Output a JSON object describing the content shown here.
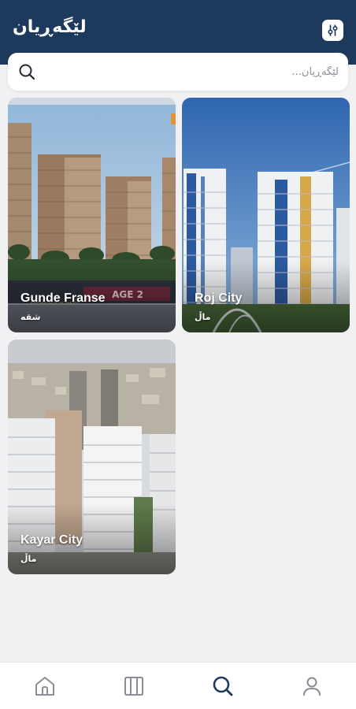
{
  "header": {
    "title": "لێگەڕیان",
    "filter_icon": "filter-icon",
    "background": "#1d3a5c"
  },
  "search": {
    "placeholder": "لێگەڕیان...",
    "icon": "search-icon"
  },
  "listings": [
    {
      "name": "Gunde Franse",
      "type": "شقە"
    },
    {
      "name": "Roj City",
      "type": "ماڵ"
    },
    {
      "name": "Kayar City",
      "type": "ماڵ"
    }
  ],
  "bottom_nav": {
    "items": [
      {
        "icon": "home-icon",
        "active": false
      },
      {
        "icon": "map-icon",
        "active": false
      },
      {
        "icon": "search-icon",
        "active": true
      },
      {
        "icon": "profile-icon",
        "active": false
      }
    ],
    "active_color": "#1d3a5c",
    "inactive_color": "#8a8f97"
  }
}
